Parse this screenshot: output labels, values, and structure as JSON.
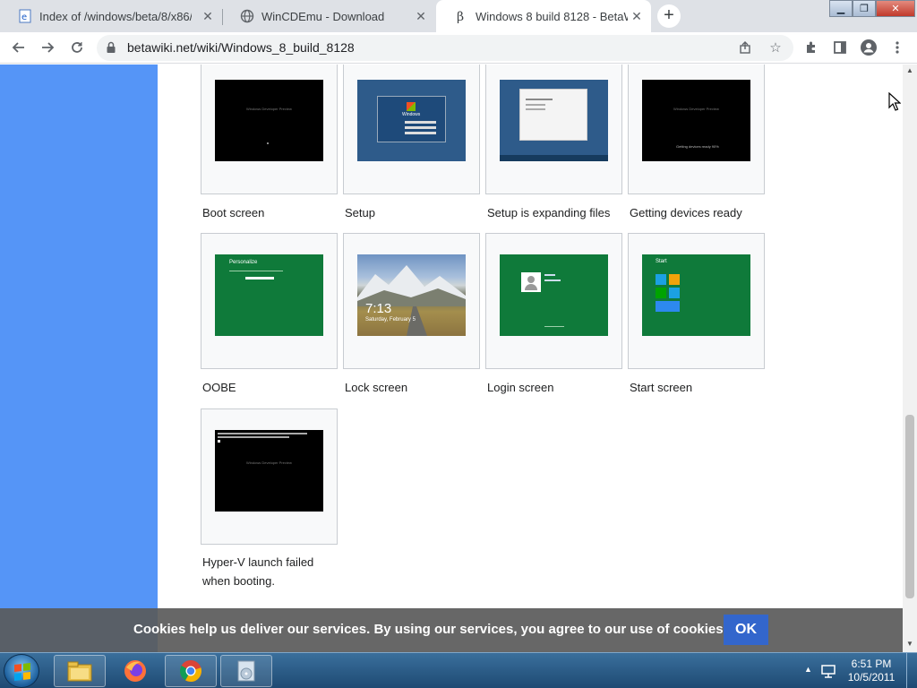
{
  "browser": {
    "tabs": [
      {
        "title": "Index of /windows/beta/8/x86/",
        "favicon": "ie-page-icon",
        "active": false
      },
      {
        "title": "WinCDEmu - Download",
        "favicon": "globe-icon",
        "active": false
      },
      {
        "title": "Windows 8 build 8128 - BetaWiki",
        "favicon": "betawiki-icon",
        "active": true
      }
    ],
    "new_tab_label": "+",
    "url": "betawiki.net/wiki/Windows_8_build_8128"
  },
  "gallery": {
    "items": [
      {
        "caption": "Boot screen",
        "image": "boot-screen-screenshot",
        "style": "black"
      },
      {
        "caption": "Setup",
        "image": "setup-screenshot",
        "style": "blue"
      },
      {
        "caption": "Setup is expanding files",
        "image": "setup-expanding-screenshot",
        "style": "blue"
      },
      {
        "caption": "Getting devices ready",
        "image": "getting-devices-screenshot",
        "style": "black"
      },
      {
        "caption": "OOBE",
        "image": "oobe-screenshot",
        "style": "green"
      },
      {
        "caption": "Lock screen",
        "image": "lock-screen-screenshot",
        "style": "landscape"
      },
      {
        "caption": "Login screen",
        "image": "login-screen-screenshot",
        "style": "green"
      },
      {
        "caption": "Start screen",
        "image": "start-screen-screenshot",
        "style": "green"
      },
      {
        "caption": "Hyper-V launch failed",
        "caption2": "when booting.",
        "image": "hyperv-failed-screenshot",
        "style": "black"
      }
    ],
    "thumb_text": {
      "boot": "Windows Developer Preview",
      "setup_logo": "Windows",
      "getting": "Getting devices ready 90%",
      "oobe": "Personalize",
      "lock_time": "7:13",
      "lock_date": "Saturday, February 5",
      "start": "Start"
    }
  },
  "cookie_banner": {
    "text": "Cookies help us deliver our services. By using our services, you agree to our use of cookies.",
    "ok_label": "OK"
  },
  "taskbar": {
    "time": "6:51 PM",
    "date": "10/5/2011",
    "items": [
      "explorer-icon",
      "firefox-icon",
      "chrome-icon",
      "media-icon"
    ]
  }
}
